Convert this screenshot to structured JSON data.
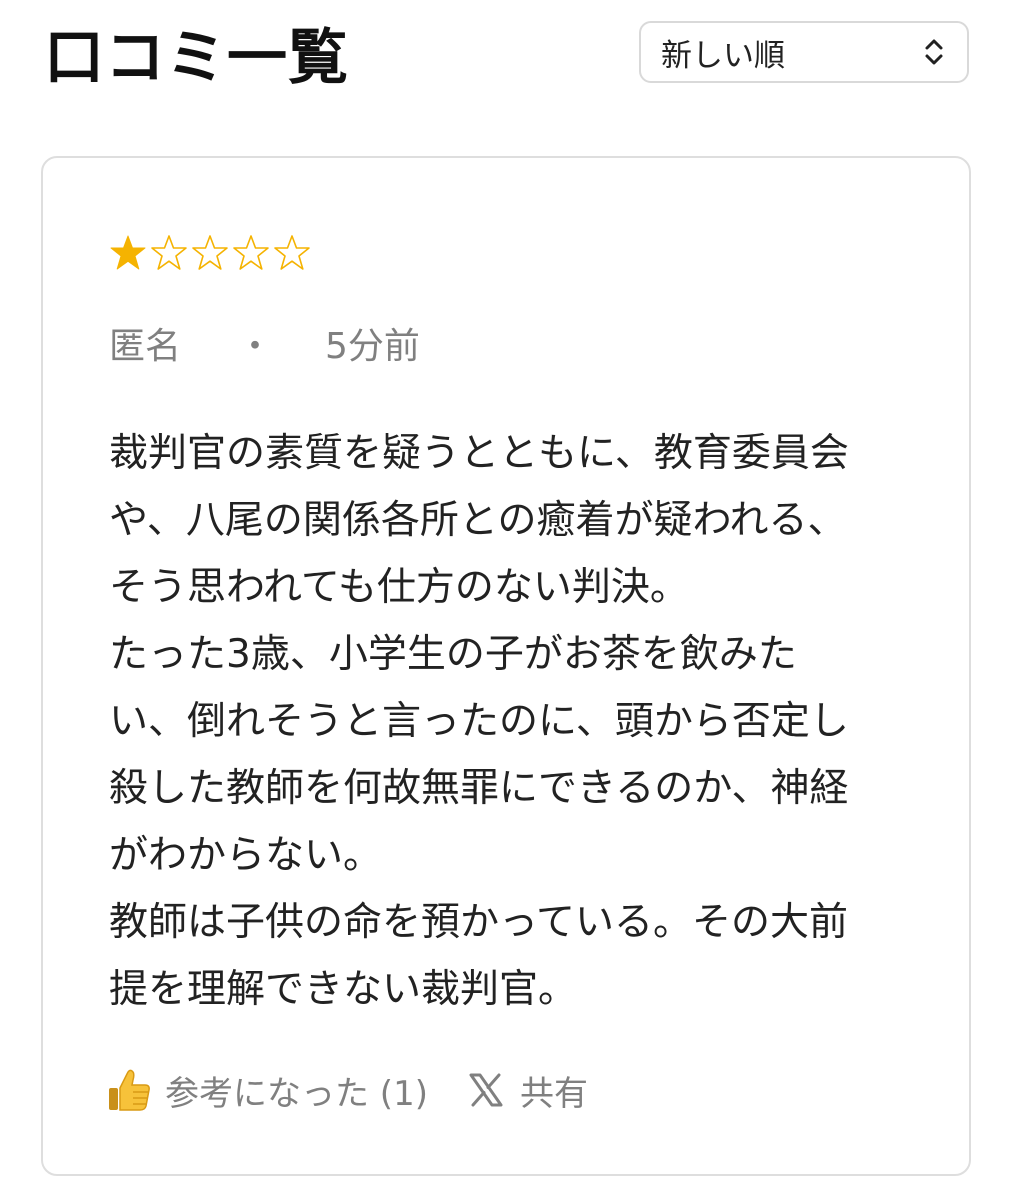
{
  "header": {
    "title": "口コミ一覧",
    "sort": {
      "selected": "新しい順",
      "icon": "chevron-up-down-icon"
    }
  },
  "review": {
    "rating": 1,
    "rating_max": 5,
    "star_color": "#f5b301",
    "author": "匿名",
    "separator": "・",
    "time": "5分前",
    "body_lines": [
      "裁判官の素質を疑うとともに、教育委員会",
      "や、八尾の関係各所との癒着が疑われる、",
      "そう思われても仕方のない判決。",
      "たった3歳、小学生の子がお茶を飲みた",
      "い、倒れそうと言ったのに、頭から否定し",
      "殺した教師を何故無罪にできるのか、神経",
      "がわからない。",
      "教師は子供の命を預かっている。その大前",
      "提を理解できない裁判官。"
    ],
    "actions": {
      "helpful_label": "参考になった (1)",
      "helpful_icon": "thumbs-up-icon",
      "share_label": "共有",
      "share_icon": "x-logo-icon"
    }
  }
}
